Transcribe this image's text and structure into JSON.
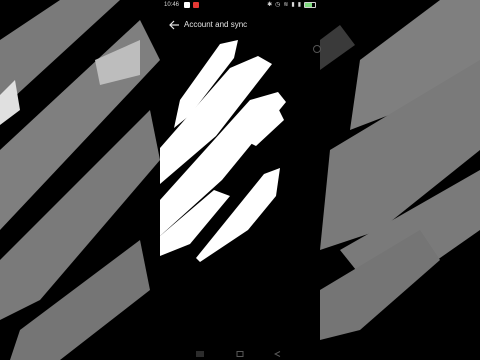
{
  "status_bar": {
    "time": "10:46",
    "app_icons": [
      "shield-icon",
      "notification-badge-icon"
    ],
    "app_icon_colors": [
      "#ffffff",
      "#e53935"
    ],
    "right_icons": [
      "bluetooth-icon",
      "alarm-icon",
      "wifi-icon",
      "signal-icon",
      "signal-icon-2"
    ],
    "battery_level": 0.7,
    "battery_color": "#7fd97f"
  },
  "app_bar": {
    "title": "Account and sync",
    "back_icon": "arrow-left-icon"
  },
  "content": {
    "overlay": "white-scribble-redaction"
  },
  "nav_bar": {
    "buttons": [
      "menu-icon",
      "home-icon",
      "back-icon"
    ]
  },
  "colors": {
    "background": "#000000",
    "blur_side": "#808080",
    "scribble": "#ffffff"
  }
}
